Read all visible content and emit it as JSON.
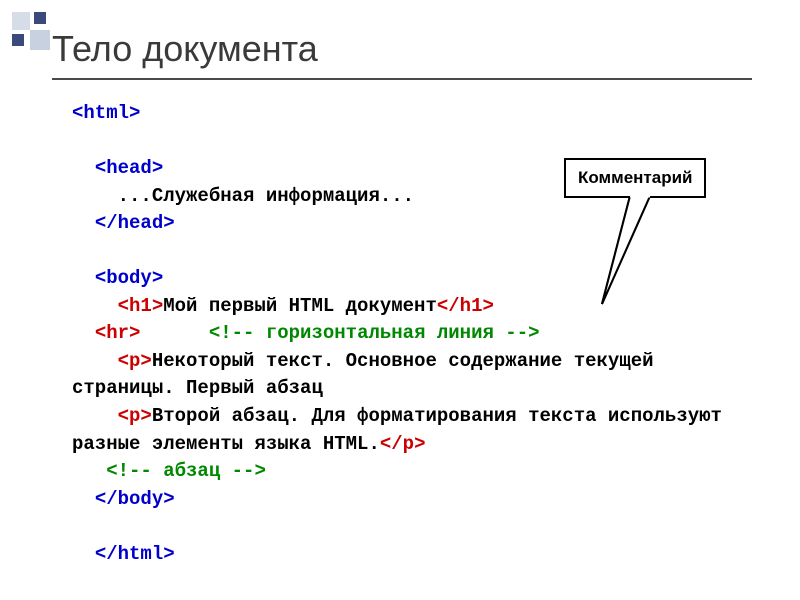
{
  "slide": {
    "title": "Тело документа"
  },
  "callout": {
    "label": "Комментарий"
  },
  "code": {
    "l1": "<html>",
    "l2": "",
    "l3_indent": "  ",
    "l3": "<head>",
    "l4_indent": "    ",
    "l4": "...Служебная информация...",
    "l5_indent": "  ",
    "l5": "</head>",
    "l6": "",
    "l7_indent": "  ",
    "l7": "<body>",
    "l8_indent": "    ",
    "l8_open": "<h1>",
    "l8_text": "Мой первый HTML документ",
    "l8_close": "</h1>",
    "l9_indent": "  ",
    "l9_tag": "<hr>",
    "l9_space": "      ",
    "l9_comment": "<!-- горизонтальная линия -->",
    "l10_indent": "    ",
    "l10_open": "<p>",
    "l10_text": "Некоторый текст. Основное содержание текущей страницы. Первый абзац",
    "l11_indent": "    ",
    "l11_open": "<p>",
    "l11_text": "Второй абзац. Для форматирования текста используют разные элементы языка HTML.",
    "l11_close": "</p>",
    "l12_indent": "   ",
    "l12_comment": "<!-- абзац -->",
    "l13_indent": "  ",
    "l13": "</body>",
    "l14": "",
    "l15_indent": "  ",
    "l15": "</html>"
  }
}
